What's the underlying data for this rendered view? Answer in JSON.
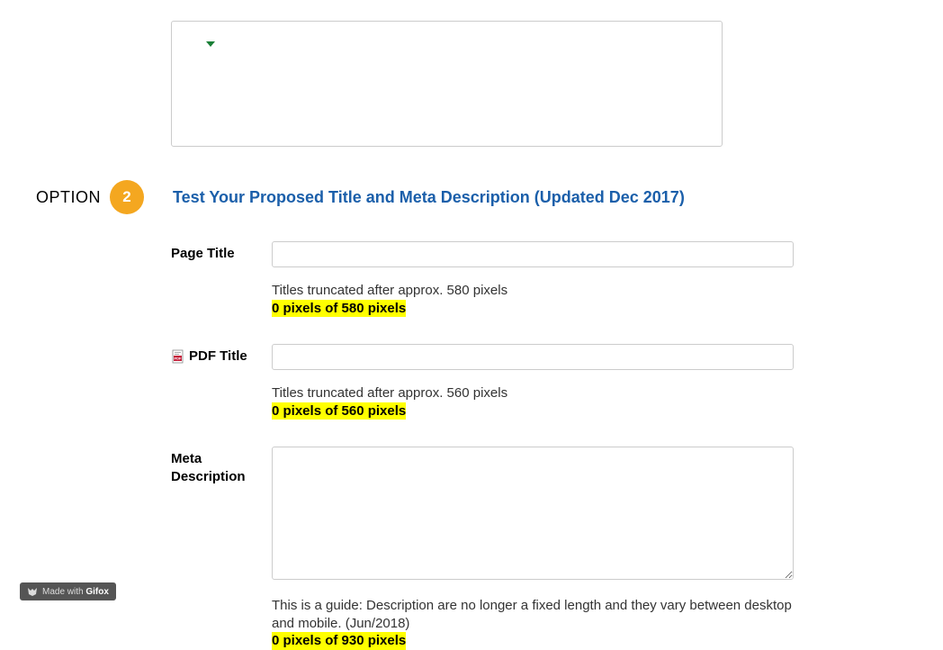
{
  "option": {
    "label": "OPTION",
    "number": "2",
    "title": "Test Your Proposed Title and Meta Description (Updated Dec 2017)"
  },
  "fields": {
    "pageTitle": {
      "label": "Page Title",
      "value": "",
      "help": "Titles truncated after approx. 580 pixels",
      "counter": "0 pixels of 580 pixels"
    },
    "pdfTitle": {
      "label": "PDF Title",
      "value": "",
      "help": "Titles truncated after approx. 560 pixels",
      "counter": "0 pixels of 560 pixels"
    },
    "metaDescription": {
      "label": "Meta Description",
      "value": "",
      "help": "This is a guide: Description are no longer a fixed length and they vary between desktop and mobile. (Jun/2018)",
      "counter": "0 pixels of 930 pixels"
    }
  },
  "badge": {
    "prefix": "Made with",
    "brand": "Gifox"
  }
}
